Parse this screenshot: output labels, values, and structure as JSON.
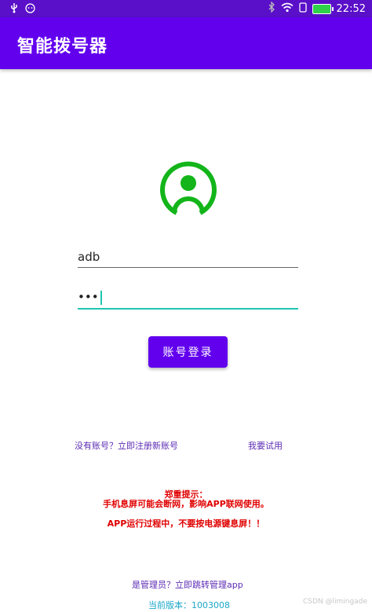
{
  "status_bar": {
    "time": "22:52",
    "left_icons": [
      "usb-icon",
      "face-icon"
    ],
    "right_icons": [
      "bluetooth-icon",
      "wifi-icon",
      "signal-icon",
      "battery-icon"
    ]
  },
  "app_bar": {
    "title": "智能拨号器"
  },
  "avatar": {
    "icon": "user-avatar-icon",
    "color": "#13b51a"
  },
  "form": {
    "username_value": "adb",
    "password_mask": "•••"
  },
  "login_button": {
    "label": "账号登录",
    "color": "#6200ee"
  },
  "links": {
    "register": "没有账号？立即注册新账号",
    "trial": "我要试用",
    "admin": "是管理员？立即跳转管理app"
  },
  "warning": {
    "title": "郑重提示：",
    "line1": "手机息屏可能会断网，影响APP联网使用。",
    "line2": "APP运行过程中，不要按电源键息屏！！"
  },
  "version": {
    "text": "当前版本：1003008"
  },
  "watermark": "CSDN @limingade"
}
